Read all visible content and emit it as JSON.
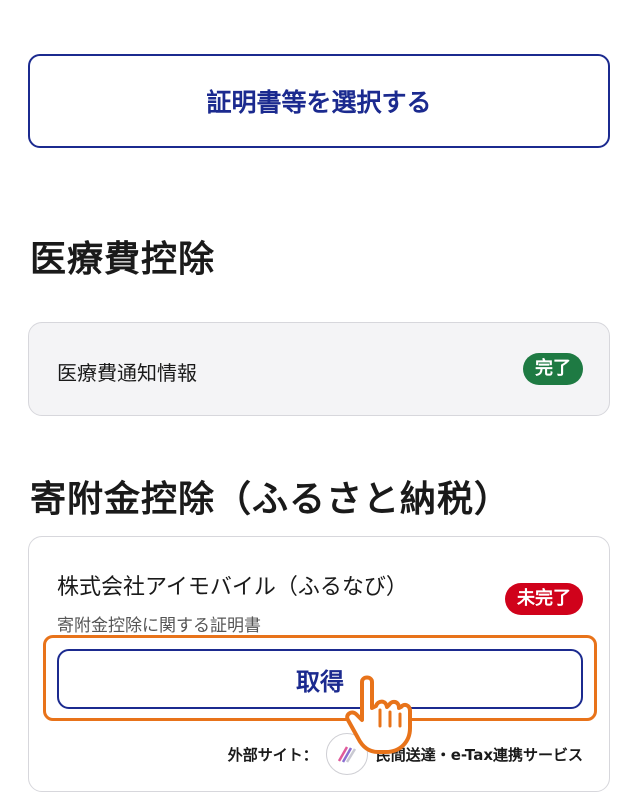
{
  "select_button": {
    "label": "証明書等を選択する"
  },
  "medical_section": {
    "title": "医療費控除",
    "item": {
      "name": "医療費通知情報",
      "status": "完了",
      "status_color": "#1e7a43"
    }
  },
  "donation_section": {
    "title": "寄附金控除（ふるさと納税）",
    "item": {
      "name": "株式会社アイモバイル（ふるなび）",
      "description": "寄附金控除に関する証明書",
      "status": "未完了",
      "status_color": "#d0021b",
      "obtain_label": "取得",
      "external_label": "外部サイト：",
      "external_service": "民間送達・e-Tax連携サービス"
    }
  },
  "colors": {
    "accent": "#1b2a8f",
    "highlight": "#e8731a"
  }
}
